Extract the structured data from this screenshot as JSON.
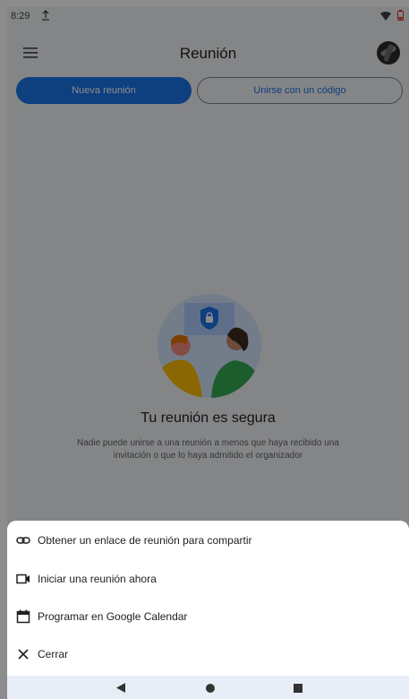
{
  "status_bar": {
    "time": "8:29",
    "icons": [
      "upload-icon",
      "wifi-icon",
      "battery-icon"
    ]
  },
  "app_bar": {
    "title": "Reunión",
    "menu_icon": "hamburger-menu-icon",
    "avatar": "account-avatar"
  },
  "actions": {
    "new_meeting": "Nueva reunión",
    "join_with_code": "Unirse con un código"
  },
  "empty_state": {
    "title": "Tu reunión es segura",
    "description": "Nadie puede unirse a una reunión a menos que haya recibido una invitación o que lo haya admitido el organizador"
  },
  "bottom_sheet": {
    "items": [
      {
        "label": "Obtener un enlace de reunión para compartir",
        "icon": "link-icon"
      },
      {
        "label": "Iniciar una reunión ahora",
        "icon": "video-camera-icon"
      },
      {
        "label": "Programar en Google Calendar",
        "icon": "calendar-icon"
      },
      {
        "label": "Cerrar",
        "icon": "close-icon"
      }
    ]
  },
  "nav_bar": {
    "icons": [
      "back-icon",
      "home-icon",
      "recents-icon"
    ]
  },
  "colors": {
    "accent": "#1a73e8",
    "background": "#f1f3f4",
    "sheet": "#ffffff",
    "navbar": "#e8eef7"
  }
}
